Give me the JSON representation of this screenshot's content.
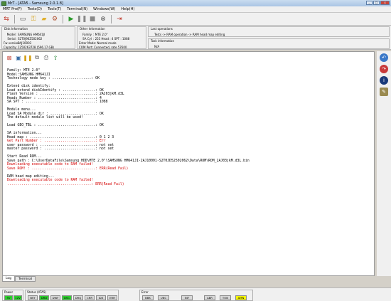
{
  "window": {
    "title": "MrT - [ATA5 - Samsung 2.0.1.8]",
    "min": "_",
    "max": "□",
    "close": "x"
  },
  "menu": [
    "MRT Pro(F)",
    "Tests(D)",
    "Tools(T)",
    "Terminal(N)",
    "Windows(W)",
    "Help(H)"
  ],
  "disk_info": {
    "title": "Disk Information",
    "rows": [
      {
        "label": "Model:",
        "value": "SAMSUNG HM641JI"
      },
      {
        "label": "Serial:",
        "value": "S2T0J90Z502062"
      },
      {
        "label": "Fw version:",
        "value": "2AJ10003"
      },
      {
        "label": "Capacity:",
        "value": "1250263728 (596.17 GB)"
      }
    ]
  },
  "other_info": {
    "title": "Other Information",
    "rows": [
      {
        "label": "Family",
        "value": ": MTE 2.0\""
      },
      {
        "label": "SA Cyl",
        "value": ": 255  Head : 4  SPT : 1088"
      },
      {
        "label": "Enter Mode:",
        "value": "Normal mode"
      },
      {
        "label": "COM Port:",
        "value": "Connected, rate 57600"
      }
    ]
  },
  "last_ops": {
    "title": "Last operations",
    "text": "Tests -> RAM operation -> RAM head map editing"
  },
  "task_info": {
    "title": "Task information",
    "text": "N/A"
  },
  "log": {
    "lines": [
      {
        "t": "Family: MTE 2.0\"",
        "c": ""
      },
      {
        "t": "Model:SAMSUNG HM641JI",
        "c": ""
      },
      {
        "t": "Technology mode key : ...................: OK",
        "c": ""
      },
      {
        "t": "",
        "c": ""
      },
      {
        "t": "Extend disk identify:",
        "c": ""
      },
      {
        "t": "Load extend diskIdentify : ................: OK",
        "c": ""
      },
      {
        "t": "Flash Version : ...........................: 2AJ03jkM.d3L",
        "c": ""
      },
      {
        "t": "Heads Number : ............................: 4",
        "c": ""
      },
      {
        "t": "SA SPT : ..................................: 1088",
        "c": ""
      },
      {
        "t": "",
        "c": ""
      },
      {
        "t": "Module menu...",
        "c": ""
      },
      {
        "t": "Load SA Module dir : ......................: OK",
        "c": ""
      },
      {
        "t": "The default module list will be used!",
        "c": ""
      },
      {
        "t": "",
        "c": ""
      },
      {
        "t": "Load GEO_TBL : ............................: OK",
        "c": ""
      },
      {
        "t": "",
        "c": ""
      },
      {
        "t": "SA information...",
        "c": ""
      },
      {
        "t": "Head map : ................................: 0 1 2 3",
        "c": ""
      },
      {
        "t": "Get Part Number : .........................: Err",
        "c": "red"
      },
      {
        "t": "user password : ...........................: not set",
        "c": ""
      },
      {
        "t": "master password : .........................: not set",
        "c": ""
      },
      {
        "t": "",
        "c": ""
      },
      {
        "t": "Start Read ROM...",
        "c": ""
      },
      {
        "t": "Save path : C:\\UserDataFile\\Samsung HDD\\MTE 2.0\"\\SAMSUNG HM641JI-2AJ10001-S2T0JD52502062\\Data\\ROM\\ROM_2AJ03jkM.d3L.bin",
        "c": ""
      },
      {
        "t": "Downloading executable code to RAM failed!",
        "c": "red"
      },
      {
        "t": "Save ROM! : ...............................: ERR(Read Fail)",
        "c": "red"
      },
      {
        "t": "",
        "c": ""
      },
      {
        "t": "RAM head map editing...",
        "c": ""
      },
      {
        "t": "Downloading executable code to RAM failed!",
        "c": "red"
      },
      {
        "t": ".........................................: ERR(Read Fail)",
        "c": "red"
      }
    ]
  },
  "tabs": [
    "Log",
    "Terminal"
  ],
  "status": {
    "power": {
      "label": "Power",
      "chips": [
        {
          "t": "5V",
          "c": "green"
        },
        {
          "t": "12V",
          "c": "green"
        }
      ]
    },
    "status": {
      "label": "Status (ATA5)",
      "chips": [
        {
          "t": "BSY",
          "c": ""
        },
        {
          "t": "DRD",
          "c": "green"
        },
        {
          "t": "DWF",
          "c": ""
        },
        {
          "t": "DSC",
          "c": "green"
        },
        {
          "t": "DRQ",
          "c": ""
        },
        {
          "t": "CRR",
          "c": ""
        },
        {
          "t": "IDX",
          "c": ""
        },
        {
          "t": "ERR",
          "c": ""
        }
      ]
    },
    "error": {
      "label": "Error",
      "chips": [
        {
          "t": "BBK",
          "c": ""
        },
        {
          "t": "UNC",
          "c": ""
        },
        {
          "t": "INF",
          "c": ""
        },
        {
          "t": "ABR",
          "c": ""
        },
        {
          "t": "TON",
          "c": ""
        },
        {
          "t": "AMN",
          "c": "yellow"
        }
      ]
    }
  }
}
